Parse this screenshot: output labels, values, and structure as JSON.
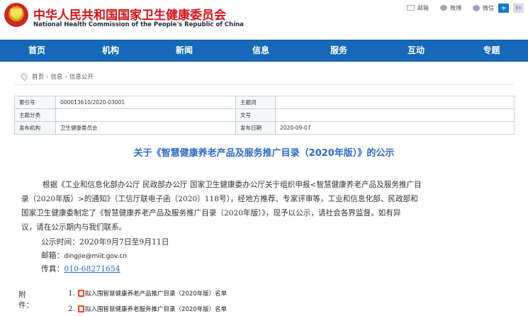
{
  "header": {
    "site_name_cn": "中华人民共和国国家卫生健康委员会",
    "site_name_en": "National Health Commission of the People's Republic of China",
    "tools": [
      {
        "label": "邮箱",
        "icon": "mail-icon"
      },
      {
        "label": "微博",
        "icon": "weibo-icon"
      },
      {
        "label": "微信",
        "icon": "wechat-icon"
      }
    ],
    "lang_cn": "中",
    "lang_en": "En"
  },
  "nav": [
    "首页",
    "机构",
    "新闻",
    "信息",
    "服务",
    "互动",
    "专题"
  ],
  "breadcrumb": [
    "首页",
    "信息",
    "信息公开"
  ],
  "meta": [
    [
      "索引号",
      "000013610/2020-03001",
      "主题词",
      ""
    ],
    [
      "主题分类",
      "",
      "文号",
      ""
    ],
    [
      "发布机构",
      "卫生健康委员会",
      "发布日期",
      "2020-09-07"
    ]
  ],
  "title": "关于《智慧健康养老产品及服务推广目录（2020年版）》的公示",
  "body_lines": [
    "根据《工业和信息化部办公厅 民政部办公厅 国家卫生健康委办公厅关于组织申报<智慧健康养老产品及服务推广目",
    "录（2020年版）>的通知》（工信厅联电子函〔2020〕118号），经地方推荐、专家评审等，工业和信息化部、民政部和",
    "国家卫生健康委制定了《智慧健康养老产品及服务推广目录（2020年版）》，现予以公示，请社会各界监督。如有异",
    "议，请在公示期内与我们联系。"
  ],
  "info": {
    "period_label": "公示时间：",
    "period_value": "2020年9月7日至9月11日",
    "email_label": "邮箱：",
    "email_value": "dingjie@miit.gov.cn",
    "fax_label": "传真：",
    "fax_value": "010-68271654"
  },
  "attachments": {
    "label": "附件：",
    "items": [
      {
        "num": "1.",
        "text": "拟入围智慧健康养老产品推广目录（2020年版）名单"
      },
      {
        "num": "2.",
        "text": "拟入围智慧健康养老服务推广目录（2020年版）名单"
      }
    ]
  }
}
